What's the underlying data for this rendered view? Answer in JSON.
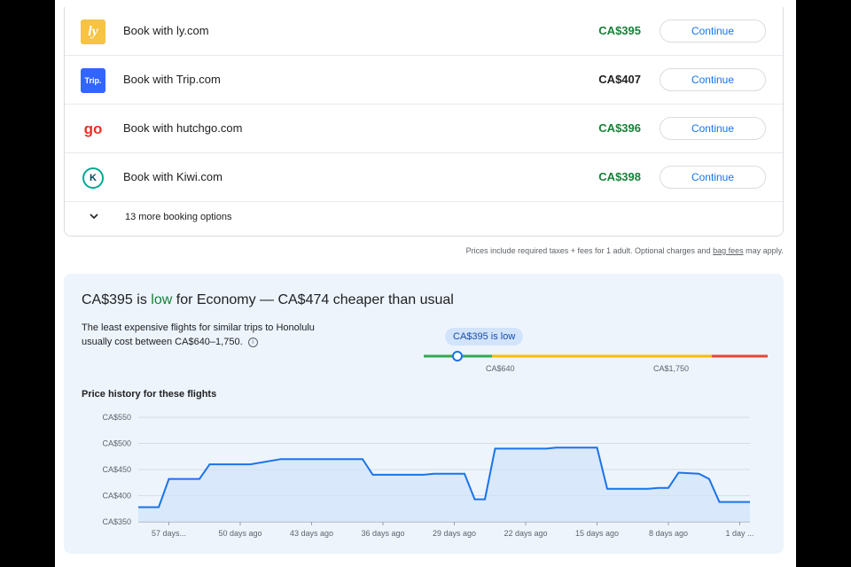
{
  "booking": {
    "options": [
      {
        "provider": "Book with ly.com",
        "price": "CA$395",
        "price_color": "green",
        "logo": "ly-logo",
        "button": "Continue"
      },
      {
        "provider": "Book with Trip.com",
        "price": "CA$407",
        "price_color": "black",
        "logo": "trip-logo",
        "button": "Continue"
      },
      {
        "provider": "Book with hutchgo.com",
        "price": "CA$396",
        "price_color": "green",
        "logo": "hutchgo-logo",
        "button": "Continue"
      },
      {
        "provider": "Book with Kiwi.com",
        "price": "CA$398",
        "price_color": "green",
        "logo": "kiwi-logo",
        "button": "Continue"
      }
    ],
    "logo_text": {
      "ly": "ly",
      "trip": "Trip.",
      "hutchgo": "go",
      "kiwi": "K"
    },
    "more_options": "13 more booking options",
    "disclaimer_pre": "Prices include required taxes + fees for 1 adult. Optional charges and",
    "disclaimer_link": "bag fees",
    "disclaimer_post": "may apply."
  },
  "insights": {
    "headline_pre": "CA$395 is",
    "headline_low": "low",
    "headline_post": "for Economy — CA$474 cheaper than usual",
    "description": "The least expensive flights for similar trips to Honolulu usually cost between CA$640–1,750.",
    "info_icon": "ⓘ",
    "gauge": {
      "bubble": "CA$395 is low",
      "low_label": "CA$640",
      "high_label": "CA$1,750",
      "current": 395,
      "low": 640,
      "high": 1750
    },
    "chart_title": "Price history for these flights"
  },
  "colors": {
    "green": "#188038",
    "accent": "#1a73e8",
    "gauge_green": "#34a853",
    "gauge_yellow": "#fbbc04",
    "gauge_red": "#ea4335",
    "fill": "#d2e3fc"
  },
  "chart_data": {
    "type": "area",
    "title": "Price history for these flights",
    "xlabel": "",
    "ylabel": "",
    "ylim": [
      350,
      550
    ],
    "y_ticks": [
      350,
      400,
      450,
      500,
      550
    ],
    "y_tick_labels": [
      "CA$350",
      "CA$400",
      "CA$450",
      "CA$500",
      "CA$550"
    ],
    "x_range": [
      -60,
      0
    ],
    "x_ticks": [
      -57,
      -50,
      -43,
      -36,
      -29,
      -22,
      -15,
      -8,
      -1
    ],
    "x_tick_labels": [
      "57 days...",
      "50 days ago",
      "43 days ago",
      "36 days ago",
      "29 days ago",
      "22 days ago",
      "15 days ago",
      "8 days ago",
      "1 day ..."
    ],
    "grid": true,
    "series": [
      {
        "x": [
          -60,
          -58,
          -57.5,
          -57,
          -54,
          -53,
          -50,
          -49,
          -46,
          -45,
          -38,
          -37,
          -32,
          -31,
          -28,
          -27,
          -26,
          -25,
          -20,
          -19,
          -15,
          -14,
          -10,
          -9,
          -8,
          -7,
          -5,
          -4,
          -3,
          -2,
          0
        ],
        "y": [
          378,
          378,
          405,
          432,
          432,
          460,
          460,
          460,
          470,
          470,
          470,
          440,
          440,
          442,
          442,
          393,
          393,
          490,
          490,
          492,
          492,
          413,
          413,
          415,
          415,
          444,
          442,
          432,
          388,
          388,
          388
        ]
      }
    ]
  }
}
